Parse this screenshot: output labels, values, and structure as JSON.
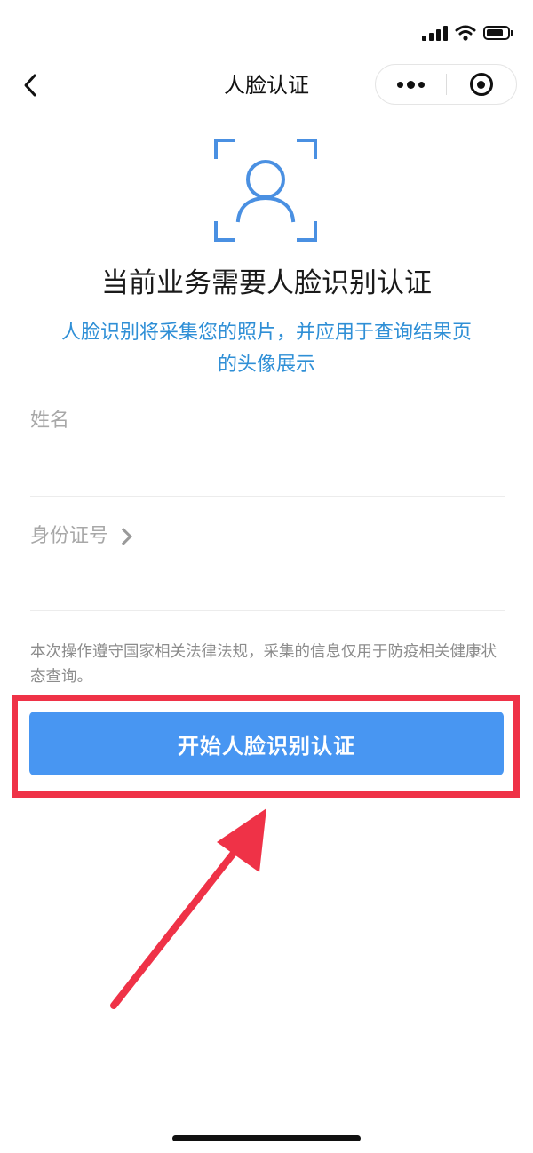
{
  "nav": {
    "title": "人脸认证"
  },
  "hero": {
    "headline": "当前业务需要人脸识别认证",
    "subtext": "人脸识别将采集您的照片，并应用于查询结果页的头像展示"
  },
  "form": {
    "name_label": "姓名",
    "name_value": "",
    "id_label": "身份证号",
    "id_value": ""
  },
  "notice": "本次操作遵守国家相关法律法规，采集的信息仅用于防疫相关健康状态查询。",
  "button": {
    "label": "开始人脸识别认证"
  },
  "colors": {
    "accent": "#4896f2",
    "link_text": "#2f8fd6",
    "highlight": "#ef3247"
  },
  "icons": [
    "back-chevron-icon",
    "more-dots-icon",
    "close-miniprogram-icon",
    "face-scan-icon",
    "chevron-right-icon",
    "signal-icon",
    "wifi-icon",
    "battery-icon"
  ]
}
